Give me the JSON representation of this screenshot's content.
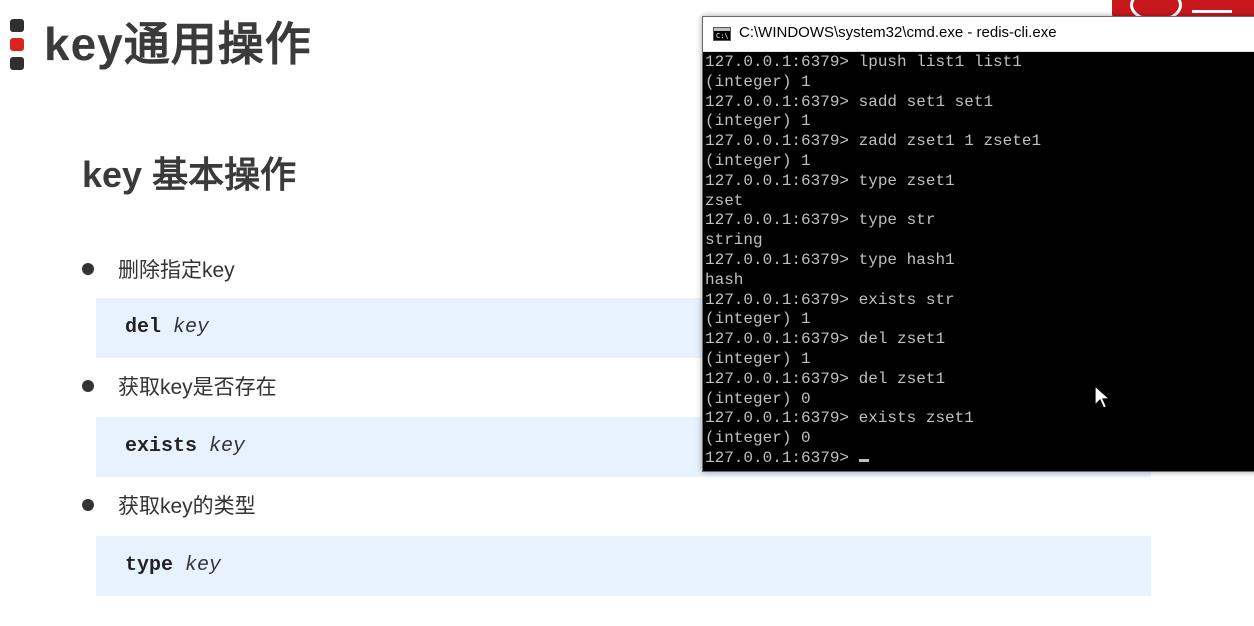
{
  "slide": {
    "title": "key通用操作",
    "section_title": "key 基本操作",
    "bullets": [
      {
        "label": "删除指定key",
        "cmd": "del",
        "arg": "key"
      },
      {
        "label": "获取key是否存在",
        "cmd": "exists",
        "arg": "key"
      },
      {
        "label": "获取key的类型",
        "cmd": "type",
        "arg": "key"
      }
    ]
  },
  "terminal": {
    "title": "C:\\WINDOWS\\system32\\cmd.exe - redis-cli.exe",
    "icon": "cmd-icon",
    "lines": [
      "127.0.0.1:6379> lpush list1 list1",
      "(integer) 1",
      "127.0.0.1:6379> sadd set1 set1",
      "(integer) 1",
      "127.0.0.1:6379> zadd zset1 1 zsete1",
      "(integer) 1",
      "127.0.0.1:6379> type zset1",
      "zset",
      "127.0.0.1:6379> type str",
      "string",
      "127.0.0.1:6379> type hash1",
      "hash",
      "127.0.0.1:6379> exists str",
      "(integer) 1",
      "127.0.0.1:6379> del zset1",
      "(integer) 1",
      "127.0.0.1:6379> del zset1",
      "(integer) 0",
      "127.0.0.1:6379> exists zset1",
      "(integer) 0"
    ],
    "prompt": "127.0.0.1:6379> "
  },
  "colors": {
    "accent_red": "#d9251c",
    "code_bg": "#e8f1fe",
    "terminal_bg": "#000000",
    "terminal_fg": "#c0c0c0"
  }
}
